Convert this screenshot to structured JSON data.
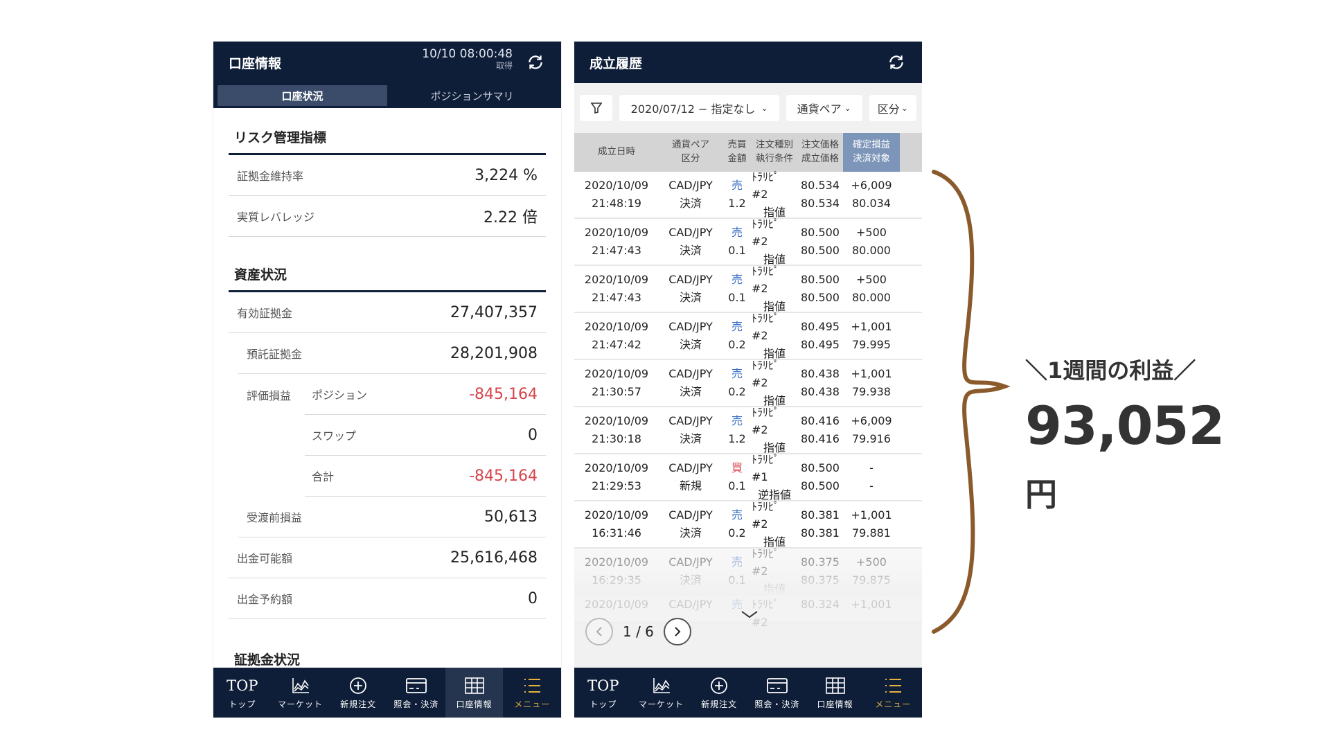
{
  "left": {
    "title": "口座情報",
    "timestamp": "10/10 08:00:48",
    "timestamp_sub": "取得",
    "tabs": [
      {
        "label": "口座状況",
        "active": true
      },
      {
        "label": "ポジションサマリ",
        "active": false
      }
    ],
    "risk": {
      "title": "リスク管理指標",
      "rows": [
        {
          "label": "証拠金維持率",
          "value": "3,224 %"
        },
        {
          "label": "実質レバレッジ",
          "value": "2.22 倍"
        }
      ]
    },
    "assets": {
      "title": "資産状況",
      "effective": {
        "label": "有効証拠金",
        "value": "27,407,357"
      },
      "deposit": {
        "label": "預託証拠金",
        "value": "28,201,908"
      },
      "valuation_label": "評価損益",
      "position": {
        "label": "ポジション",
        "value": "-845,164"
      },
      "swap": {
        "label": "スワップ",
        "value": "0"
      },
      "total": {
        "label": "合計",
        "value": "-845,164"
      },
      "pre_settlement": {
        "label": "受渡前損益",
        "value": "50,613"
      },
      "withdrawable": {
        "label": "出金可能額",
        "value": "25,616,468"
      },
      "withdraw_reserved": {
        "label": "出金予約額",
        "value": "0"
      }
    },
    "margin_title": "証拠金状況"
  },
  "right": {
    "title": "成立履歴",
    "filters": {
      "date": "2020/07/12 − 指定なし",
      "pair": "通貨ペア",
      "kind": "区分"
    },
    "headers": [
      [
        "成立日時",
        ""
      ],
      [
        "通貨ペア",
        "区分"
      ],
      [
        "売買",
        "金額"
      ],
      [
        "注文種別",
        "執行条件"
      ],
      [
        "注文価格",
        "成立価格"
      ],
      [
        "確定損益",
        "決済対象"
      ]
    ],
    "rows": [
      {
        "date": "2020/10/09",
        "time": "21:48:19",
        "pair": "CAD/JPY",
        "kind": "決済",
        "side": "売",
        "amt": "1.2",
        "otype": "ﾄﾗﾘﾋﾟ #2",
        "cond": "指値",
        "oprice": "80.534",
        "fprice": "80.534",
        "pl": "+6,009",
        "target": "80.034"
      },
      {
        "date": "2020/10/09",
        "time": "21:47:43",
        "pair": "CAD/JPY",
        "kind": "決済",
        "side": "売",
        "amt": "0.1",
        "otype": "ﾄﾗﾘﾋﾟ #2",
        "cond": "指値",
        "oprice": "80.500",
        "fprice": "80.500",
        "pl": "+500",
        "target": "80.000"
      },
      {
        "date": "2020/10/09",
        "time": "21:47:43",
        "pair": "CAD/JPY",
        "kind": "決済",
        "side": "売",
        "amt": "0.1",
        "otype": "ﾄﾗﾘﾋﾟ #2",
        "cond": "指値",
        "oprice": "80.500",
        "fprice": "80.500",
        "pl": "+500",
        "target": "80.000"
      },
      {
        "date": "2020/10/09",
        "time": "21:47:42",
        "pair": "CAD/JPY",
        "kind": "決済",
        "side": "売",
        "amt": "0.2",
        "otype": "ﾄﾗﾘﾋﾟ #2",
        "cond": "指値",
        "oprice": "80.495",
        "fprice": "80.495",
        "pl": "+1,001",
        "target": "79.995"
      },
      {
        "date": "2020/10/09",
        "time": "21:30:57",
        "pair": "CAD/JPY",
        "kind": "決済",
        "side": "売",
        "amt": "0.2",
        "otype": "ﾄﾗﾘﾋﾟ #2",
        "cond": "指値",
        "oprice": "80.438",
        "fprice": "80.438",
        "pl": "+1,001",
        "target": "79.938"
      },
      {
        "date": "2020/10/09",
        "time": "21:30:18",
        "pair": "CAD/JPY",
        "kind": "決済",
        "side": "売",
        "amt": "1.2",
        "otype": "ﾄﾗﾘﾋﾟ #2",
        "cond": "指値",
        "oprice": "80.416",
        "fprice": "80.416",
        "pl": "+6,009",
        "target": "79.916"
      },
      {
        "date": "2020/10/09",
        "time": "21:29:53",
        "pair": "CAD/JPY",
        "kind": "新規",
        "side": "買",
        "amt": "0.1",
        "otype": "ﾄﾗﾘﾋﾟ #1",
        "cond": "逆指値",
        "oprice": "80.500",
        "fprice": "80.500",
        "pl": "-",
        "target": "-"
      },
      {
        "date": "2020/10/09",
        "time": "16:31:46",
        "pair": "CAD/JPY",
        "kind": "決済",
        "side": "売",
        "amt": "0.2",
        "otype": "ﾄﾗﾘﾋﾟ #2",
        "cond": "指値",
        "oprice": "80.381",
        "fprice": "80.381",
        "pl": "+1,001",
        "target": "79.881"
      },
      {
        "date": "2020/10/09",
        "time": "16:29:35",
        "pair": "CAD/JPY",
        "kind": "決済",
        "side": "売",
        "amt": "0.1",
        "otype": "ﾄﾗﾘﾋﾟ #2",
        "cond": "指値",
        "oprice": "80.375",
        "fprice": "80.375",
        "pl": "+500",
        "target": "79.875"
      },
      {
        "date": "2020/10/09",
        "time": "",
        "pair": "CAD/JPY",
        "kind": "",
        "side": "売",
        "amt": "",
        "otype": "ﾄﾗﾘﾋﾟ #2",
        "cond": "",
        "oprice": "80.324",
        "fprice": "",
        "pl": "+1,001",
        "target": ""
      }
    ],
    "pager": "1 / 6"
  },
  "tabbar": [
    {
      "icon": "top-icon",
      "glyph": "TOP",
      "label": "トップ"
    },
    {
      "icon": "chart-icon",
      "glyph": "",
      "label": "マーケット"
    },
    {
      "icon": "plus-circle-icon",
      "glyph": "",
      "label": "新規注文"
    },
    {
      "icon": "card-icon",
      "glyph": "",
      "label": "照会・決済"
    },
    {
      "icon": "grid-icon",
      "glyph": "",
      "label": "口座情報"
    },
    {
      "icon": "menu-icon",
      "glyph": "",
      "label": "メニュー"
    }
  ],
  "annotation": {
    "line1": "＼1週間の利益／",
    "amount": "93,052",
    "unit": "円"
  },
  "colors": {
    "navy": "#0f1e38",
    "negative": "#d9434a",
    "sell": "#3b6fc4",
    "brace": "#8b5a2b"
  }
}
